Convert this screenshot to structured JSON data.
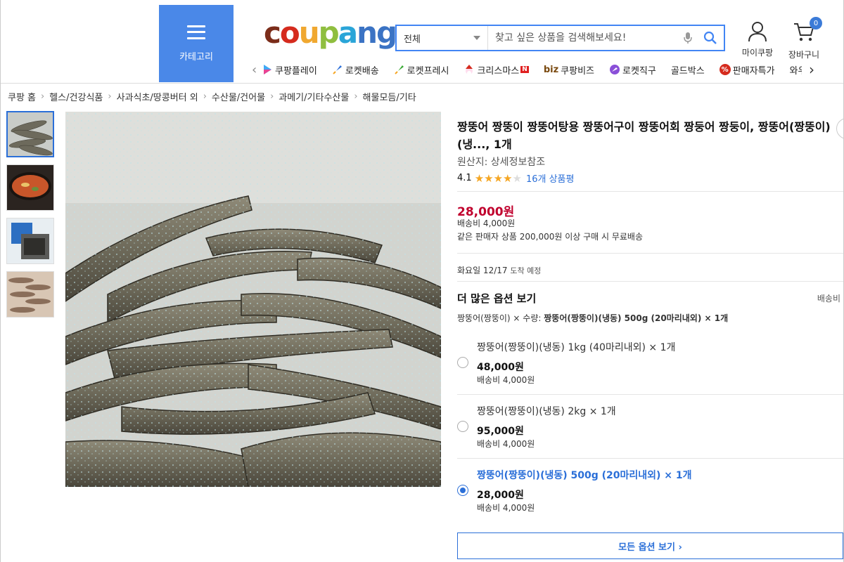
{
  "header": {
    "category_label": "카테고리",
    "logo": [
      "c",
      "o",
      "u",
      "p",
      "a",
      "n",
      "g"
    ],
    "search": {
      "category": "전체",
      "placeholder": "찾고 싶은 상품을 검색해보세요!"
    },
    "my_coupang": "마이쿠팡",
    "cart_label": "장바구니",
    "cart_count": "0",
    "shortcuts": [
      {
        "label": "쿠팡플레이",
        "icon": "play-icon"
      },
      {
        "label": "로켓배송",
        "icon": "rocket-icon"
      },
      {
        "label": "로켓프레시",
        "icon": "rocket-fresh-icon"
      },
      {
        "label": "크리스마스",
        "icon": "santa-icon"
      },
      {
        "label": "쿠팡비즈",
        "icon": "biz-icon"
      },
      {
        "label": "로켓직구",
        "icon": "globe-icon"
      },
      {
        "label": "골드박스",
        "icon": ""
      },
      {
        "label": "판매자특가",
        "icon": "percent-icon"
      },
      {
        "label": "와우회원할인",
        "icon": ""
      }
    ],
    "shortcut_biz_prefix": "biz",
    "christmas_badge": "N",
    "percent_badge": "%"
  },
  "breadcrumb": [
    "쿠팡 홈",
    "헬스/건강식품",
    "사과식초/땅콩버터 외",
    "수산물/건어물",
    "과메기/기타수산물",
    "해물모듬/기타"
  ],
  "product": {
    "title": "짱뚱어 짱뚱이 짱뚱어탕용 짱뚱어구이 짱뚱어회 짱둥어 짱둥이, 짱뚱어(짱뚱이)(냉..., 1개",
    "origin": "원산지: 상세정보참조",
    "rating": "4.1",
    "stars": 4,
    "reviews": "16개 상품평",
    "price": "28,000원",
    "shipping_fee": "배송비 4,000원",
    "free_ship_note": "같은 판매자 상품 200,000원 이상 구매 시 무료배송",
    "arrival_day": "화요일 12/17",
    "arrival_suffix": "도착 예정",
    "more_options": "더 많은 옵션 보기",
    "shipping_right": "배송비",
    "selected_prefix": "짱뚱어(짱뚱이) × 수량:",
    "selected_value": "짱뚱어(짱뚱이)(냉동) 500g (20마리내외) × 1개",
    "options": [
      {
        "name": "짱뚱어(짱뚱이)(냉동) 1kg (40마리내외) × 1개",
        "price": "48,000원",
        "ship": "배송비 4,000원",
        "selected": false
      },
      {
        "name": "짱뚱어(짱뚱이)(냉동) 2kg × 1개",
        "price": "95,000원",
        "ship": "배송비 4,000원",
        "selected": false
      },
      {
        "name": "짱뚱어(짱뚱이)(냉동) 500g (20마리내외) × 1개",
        "price": "28,000원",
        "ship": "배송비 4,000원",
        "selected": true
      }
    ],
    "all_options_button": "모든 옵션 보기 ›"
  },
  "colors": {
    "accent": "#2b6fd8",
    "price": "#c0002d",
    "category_button": "#4a88e8",
    "star": "#f5a623"
  }
}
